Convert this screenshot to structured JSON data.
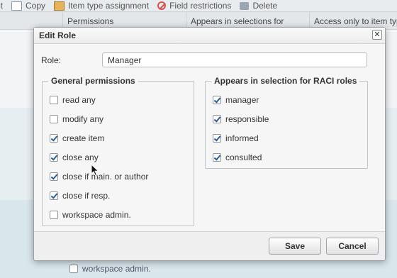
{
  "toolbar": {
    "items": [
      {
        "label": "it",
        "icon": "edit-icon"
      },
      {
        "label": "Copy",
        "icon": "copy-icon"
      },
      {
        "label": "Item type assignment",
        "icon": "item-type-icon"
      },
      {
        "label": "Field restrictions",
        "icon": "restriction-icon"
      },
      {
        "label": "Delete",
        "icon": "trash-icon"
      }
    ]
  },
  "table": {
    "columns": [
      "Permissions",
      "Appears in selections for",
      "Access only to item type"
    ]
  },
  "background": {
    "workspace_admin_label": "workspace admin."
  },
  "dialog": {
    "title": "Edit Role",
    "close_glyph": "✕",
    "role_label": "Role:",
    "role_value": "Manager",
    "general": {
      "legend": "General permissions",
      "items": [
        {
          "label": "read any",
          "checked": false
        },
        {
          "label": "modify any",
          "checked": false
        },
        {
          "label": "create item",
          "checked": true
        },
        {
          "label": "close any",
          "checked": true
        },
        {
          "label": "close if main. or author",
          "checked": true
        },
        {
          "label": "close if resp.",
          "checked": true
        },
        {
          "label": "workspace admin.",
          "checked": false
        }
      ]
    },
    "raci": {
      "legend": "Appears in selection for RACI roles",
      "items": [
        {
          "label": "manager",
          "checked": true
        },
        {
          "label": "responsible",
          "checked": true
        },
        {
          "label": "informed",
          "checked": true
        },
        {
          "label": "consulted",
          "checked": true
        }
      ]
    },
    "save_label": "Save",
    "cancel_label": "Cancel"
  },
  "colors": {
    "check": "#2a5d9f",
    "dialog_bg": "#f6f6f6",
    "backdrop": "#e6eef2"
  }
}
